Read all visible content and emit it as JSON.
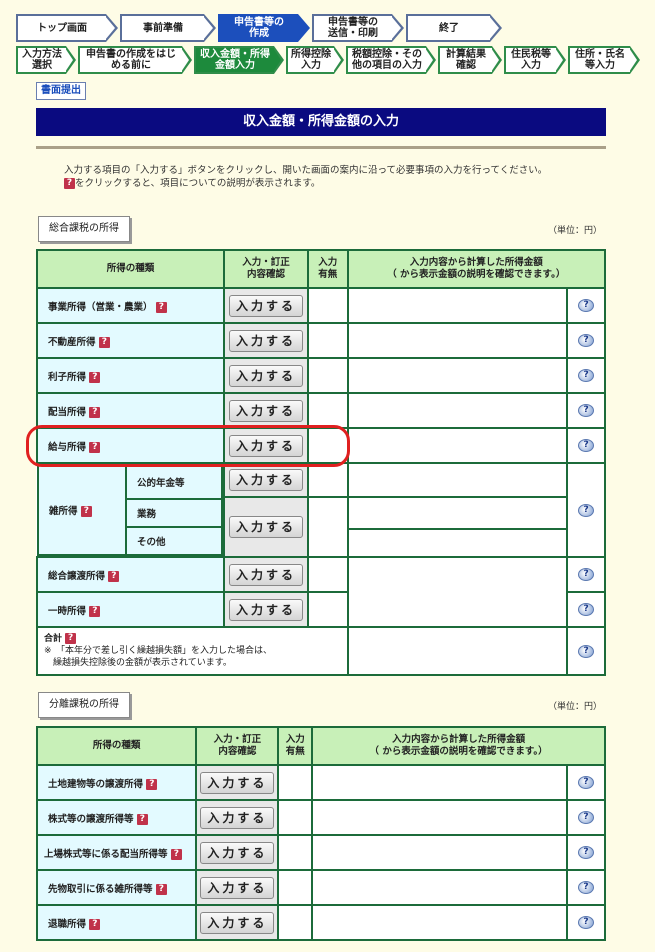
{
  "steps": [
    "トップ画面",
    "事前準備",
    "申告書等の\n作成",
    "申告書等の\n送信・印刷",
    "終了"
  ],
  "substeps": [
    "入力方法\n選択",
    "申告書の作成をはじ\nめる前に",
    "収入金額・所得\n金額入力",
    "所得控除\n入力",
    "税額控除・その\n他の項目の入力",
    "計算結果\n確認",
    "住民税等\n入力",
    "住所・氏名\n等入力"
  ],
  "submit_label": "書面提出",
  "page_title": "収入金額・所得金額の入力",
  "desc_line1": "入力する項目の「入力する」ボタンをクリックし、開いた画面の案内に沿って必要事項の入力を行ってください。",
  "desc_line2": "をクリックすると、項目についての説明が表示されます。",
  "qmark": "?",
  "help_glyph": "?",
  "section1": {
    "title": "総合課税の所得",
    "unit": "（単位：円）",
    "headers": {
      "kind": "所得の種類",
      "confirm": "入力・訂正\n内容確認",
      "flag": "入力\n有無",
      "calc": "入力内容から計算した所得金額\n（ から表示金額の説明を確認できます。）"
    },
    "button_label": "入力する",
    "rows": [
      "事業所得（営業・農業）",
      "不動産所得",
      "利子所得",
      "配当所得",
      "給与所得"
    ],
    "misc": {
      "label": "雑所得",
      "subs": [
        "公的年金等",
        "業務",
        "その他"
      ]
    },
    "rows2": [
      "総合譲渡所得",
      "一時所得"
    ],
    "total": {
      "label": "合計",
      "note": "※　「本年分で差し引く繰越損失額」を入力した場合は、\n　繰越損失控除後の金額が表示されています。"
    }
  },
  "section2": {
    "title": "分離課税の所得",
    "unit": "（単位：円）",
    "rows": [
      "土地建物等の譲渡所得",
      "株式等の譲渡所得等",
      "上場株式等に係る配当所得等",
      "先物取引に係る雑所得等",
      "退職所得"
    ]
  },
  "colors": {
    "accent_blue": "#0a0a80",
    "header_green": "#c8f0b8",
    "border_green": "#1c6b3a",
    "highlight_red": "#e02020"
  }
}
